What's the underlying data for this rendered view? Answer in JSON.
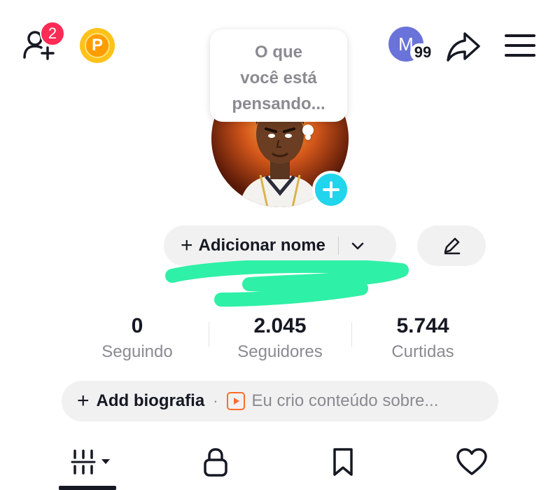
{
  "header": {
    "friend_requests_count": "2",
    "coin_letter": "P",
    "account_initial": "M",
    "account_badge": "99",
    "icons": [
      "add-friend-icon",
      "coin-icon",
      "share-icon",
      "hamburger-menu-icon"
    ]
  },
  "profile": {
    "thought_bubble_lines": [
      "O que",
      "você está",
      "pensando..."
    ],
    "add_name_label": "Adicionar nome",
    "add_name_plus": "+"
  },
  "stats": [
    {
      "value": "0",
      "label": "Seguindo"
    },
    {
      "value": "2.045",
      "label": "Seguidores"
    },
    {
      "value": "5.744",
      "label": "Curtidas"
    }
  ],
  "bio": {
    "plus": "+",
    "add_label": "Add biografia",
    "separator": "·",
    "hint": "Eu crio conteúdo sobre..."
  },
  "tabs": [
    {
      "name": "videos-grid",
      "icon": "grid-icon",
      "active": true
    },
    {
      "name": "private",
      "icon": "lock-icon",
      "active": false
    },
    {
      "name": "saved",
      "icon": "bookmark-icon",
      "active": false
    },
    {
      "name": "liked",
      "icon": "heart-icon",
      "active": false
    }
  ],
  "colors": {
    "accent_red": "#fe2c55",
    "accent_cyan": "#20d5ec",
    "coin_yellow": "#ffc21a",
    "scribble_green": "#2ef0a6",
    "pill_gray": "#f1f1f2",
    "muted_text": "#8a8b91"
  }
}
